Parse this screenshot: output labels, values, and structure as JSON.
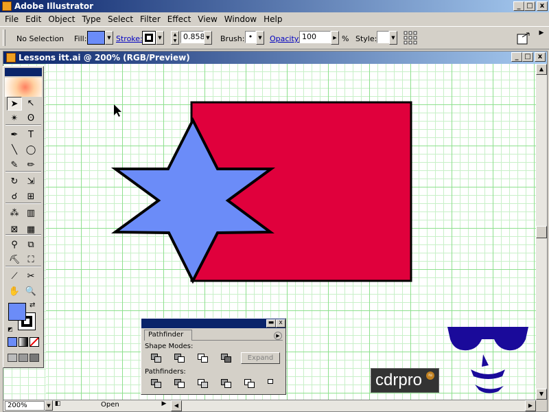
{
  "app": {
    "title": "Adobe Illustrator"
  },
  "window_controls": {
    "minimize": "_",
    "maximize": "□",
    "close": "x"
  },
  "menu": [
    "File",
    "Edit",
    "Object",
    "Type",
    "Select",
    "Filter",
    "Effect",
    "View",
    "Window",
    "Help"
  ],
  "control_bar": {
    "selection": "No Selection",
    "fill_label": "Fill:",
    "stroke_label": "Stroke:",
    "stroke_weight": "0.858",
    "brush_label": "Brush:",
    "brush_value": "•",
    "opacity_label": "Opacity:",
    "opacity_value": "100",
    "percent": "%",
    "style_label": "Style:"
  },
  "document": {
    "title": "Lessons itt.ai @ 200% (RGB/Preview)",
    "zoom": "200%",
    "status": "Open"
  },
  "colors": {
    "fill": "#6b8cf8",
    "rectangle": "#e0003c",
    "star": "#6b8cf8",
    "stroke": "#000000",
    "grid": "#8ee08e"
  },
  "tools": [
    {
      "name": "selection-tool",
      "glyph": "➤"
    },
    {
      "name": "direct-selection-tool",
      "glyph": "↖"
    },
    {
      "name": "magic-wand-tool",
      "glyph": "✴"
    },
    {
      "name": "lasso-tool",
      "glyph": "ʘ"
    },
    {
      "name": "pen-tool",
      "glyph": "✒"
    },
    {
      "name": "type-tool",
      "glyph": "T"
    },
    {
      "name": "line-tool",
      "glyph": "╲"
    },
    {
      "name": "ellipse-tool",
      "glyph": "◯"
    },
    {
      "name": "paintbrush-tool",
      "glyph": "✎"
    },
    {
      "name": "pencil-tool",
      "glyph": "✏"
    },
    {
      "name": "rotate-tool",
      "glyph": "↻"
    },
    {
      "name": "scale-tool",
      "glyph": "⇲"
    },
    {
      "name": "warp-tool",
      "glyph": "☌"
    },
    {
      "name": "free-transform-tool",
      "glyph": "⊞"
    },
    {
      "name": "symbol-sprayer-tool",
      "glyph": "⁂"
    },
    {
      "name": "graph-tool",
      "glyph": "▥"
    },
    {
      "name": "mesh-tool",
      "glyph": "⊠"
    },
    {
      "name": "gradient-tool",
      "glyph": "▦"
    },
    {
      "name": "eyedropper-tool",
      "glyph": "⚲"
    },
    {
      "name": "blend-tool",
      "glyph": "⧉"
    },
    {
      "name": "live-paint-tool",
      "glyph": "⛏"
    },
    {
      "name": "live-paint-selection-tool",
      "glyph": "⛶"
    },
    {
      "name": "slice-tool",
      "glyph": "⟋"
    },
    {
      "name": "scissors-tool",
      "glyph": "✂"
    },
    {
      "name": "hand-tool",
      "glyph": "✋"
    },
    {
      "name": "zoom-tool",
      "glyph": "🔍"
    }
  ],
  "pathfinder": {
    "tab": "Pathfinder",
    "shape_modes_label": "Shape Modes:",
    "pathfinders_label": "Pathfinders:",
    "expand_label": "Expand"
  },
  "watermark": {
    "text": "cdrpro",
    "badge": "ru"
  }
}
